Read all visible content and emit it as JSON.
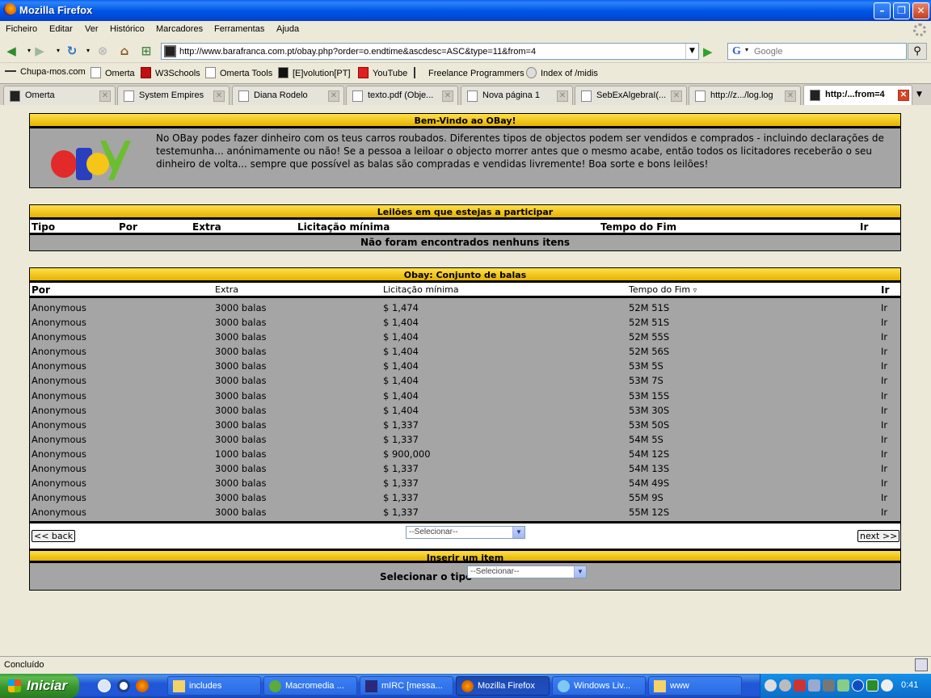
{
  "window": {
    "title": "Mozilla Firefox"
  },
  "menu": [
    "Ficheiro",
    "Editar",
    "Ver",
    "Histórico",
    "Marcadores",
    "Ferramentas",
    "Ajuda"
  ],
  "url": "http://www.barafranca.com.pt/obay.php?order=o.endtime&ascdesc=ASC&type=11&from=4",
  "search_placeholder": "Google",
  "bookmarks": [
    "Chupa-mos.com",
    "Omerta",
    "W3Schools",
    "Omerta Tools",
    "[E]volution[PT]",
    "YouTube",
    "Freelance Programmers",
    "Index of /midis"
  ],
  "tabs": [
    {
      "label": "Omerta"
    },
    {
      "label": "System Empires"
    },
    {
      "label": "Diana Rodelo"
    },
    {
      "label": "texto.pdf (Obje..."
    },
    {
      "label": "Nova página 1"
    },
    {
      "label": "SebExAlgebraI(..."
    },
    {
      "label": "http://z.../log.log"
    },
    {
      "label": "http:/...from=4"
    }
  ],
  "welcome": {
    "header": "Bem-Vindo ao OBay!",
    "logo_text": "oBaY",
    "text": "No OBay podes fazer dinheiro com os teus carros roubados. Diferentes tipos de objectos podem ser vendidos e comprados - incluindo declarações de testemunha... anónimamente ou não! Se a pessoa a leiloar o objecto morrer antes que o mesmo acabe, então todos os licitadores receberão o seu dinheiro de volta... sempre que possível as balas são compradas e vendidas livremente! Boa sorte e bons leilões!"
  },
  "participating": {
    "header": "Leilões em que estejas a participar",
    "columns": [
      "Tipo",
      "Por",
      "Extra",
      "Licitação mínima",
      "Tempo do Fim",
      "Ir"
    ],
    "empty": "Não foram encontrados nenhuns itens"
  },
  "bullets": {
    "header": "Obay: Conjunto de balas",
    "columns": [
      "Por",
      "Extra",
      "Licitação mínima",
      "Tempo do Fim",
      "Ir"
    ],
    "sort_glyph": "▿",
    "rows": [
      {
        "by": "Anonymous",
        "extra": "3000 balas",
        "min": "$ 1,474",
        "end": "52M 51S",
        "go": "Ir"
      },
      {
        "by": "Anonymous",
        "extra": "3000 balas",
        "min": "$ 1,404",
        "end": "52M 51S",
        "go": "Ir"
      },
      {
        "by": "Anonymous",
        "extra": "3000 balas",
        "min": "$ 1,404",
        "end": "52M 55S",
        "go": "Ir"
      },
      {
        "by": "Anonymous",
        "extra": "3000 balas",
        "min": "$ 1,404",
        "end": "52M 56S",
        "go": "Ir"
      },
      {
        "by": "Anonymous",
        "extra": "3000 balas",
        "min": "$ 1,404",
        "end": "53M 5S",
        "go": "Ir"
      },
      {
        "by": "Anonymous",
        "extra": "3000 balas",
        "min": "$ 1,404",
        "end": "53M 7S",
        "go": "Ir"
      },
      {
        "by": "Anonymous",
        "extra": "3000 balas",
        "min": "$ 1,404",
        "end": "53M 15S",
        "go": "Ir"
      },
      {
        "by": "Anonymous",
        "extra": "3000 balas",
        "min": "$ 1,404",
        "end": "53M 30S",
        "go": "Ir"
      },
      {
        "by": "Anonymous",
        "extra": "3000 balas",
        "min": "$ 1,337",
        "end": "53M 50S",
        "go": "Ir"
      },
      {
        "by": "Anonymous",
        "extra": "3000 balas",
        "min": "$ 1,337",
        "end": "54M 5S",
        "go": "Ir"
      },
      {
        "by": "Anonymous",
        "extra": "1000 balas",
        "min": "$ 900,000",
        "end": "54M 12S",
        "go": "Ir"
      },
      {
        "by": "Anonymous",
        "extra": "3000 balas",
        "min": "$ 1,337",
        "end": "54M 13S",
        "go": "Ir"
      },
      {
        "by": "Anonymous",
        "extra": "3000 balas",
        "min": "$ 1,337",
        "end": "54M 49S",
        "go": "Ir"
      },
      {
        "by": "Anonymous",
        "extra": "3000 balas",
        "min": "$ 1,337",
        "end": "55M 9S",
        "go": "Ir"
      },
      {
        "by": "Anonymous",
        "extra": "3000 balas",
        "min": "$ 1,337",
        "end": "55M 12S",
        "go": "Ir"
      }
    ],
    "back_label": "<< back",
    "next_label": "next >>",
    "select_value": "--Selecionar--"
  },
  "insert": {
    "header": "Inserir um item",
    "label": "Selecionar o tipo",
    "select_value": "--Selecionar--"
  },
  "status": "Concluído",
  "taskbar": {
    "start": "Iniciar",
    "tasks": [
      "includes",
      "Macromedia ...",
      "mIRC [messa...",
      "Mozilla Firefox",
      "Windows Liv...",
      "www"
    ],
    "clock": "0:41"
  },
  "colors": {
    "accent": "#E5B200",
    "panel": "#A5A5A5",
    "xp_blue": "#2157D7"
  }
}
